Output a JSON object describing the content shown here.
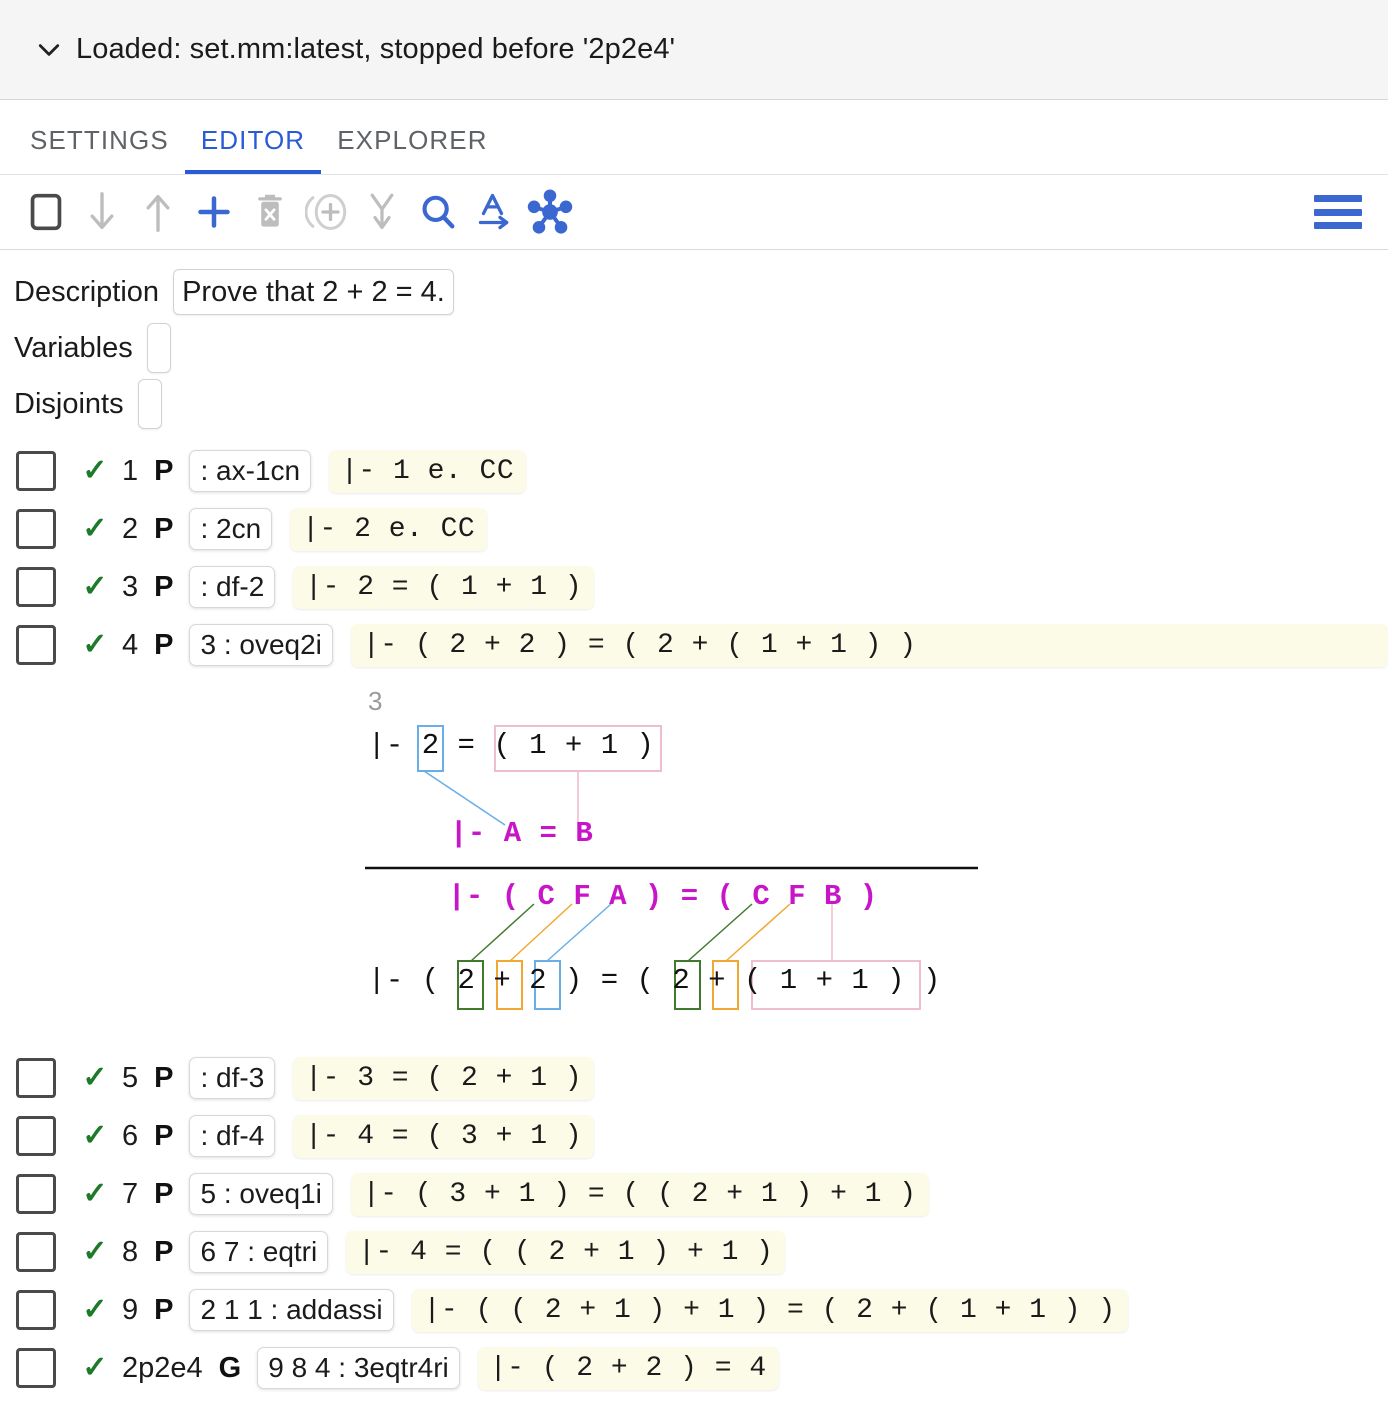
{
  "status": {
    "text": "Loaded: set.mm:latest, stopped before '2p2e4'",
    "chevron_icon": "chevron-down-icon"
  },
  "tabs": [
    {
      "label": "SETTINGS",
      "active": false
    },
    {
      "label": "EDITOR",
      "active": true
    },
    {
      "label": "EXPLORER",
      "active": false
    }
  ],
  "toolbar": {
    "icons": [
      {
        "name": "select-all-icon",
        "color": "#4a4a4a"
      },
      {
        "name": "move-down-icon",
        "color": "#bdbdbd"
      },
      {
        "name": "move-up-icon",
        "color": "#bdbdbd"
      },
      {
        "name": "add-step-icon",
        "color": "#3a68d0"
      },
      {
        "name": "delete-step-icon",
        "color": "#bdbdbd"
      },
      {
        "name": "duplicate-icon",
        "color": "#bdbdbd"
      },
      {
        "name": "merge-icon",
        "color": "#bdbdbd"
      },
      {
        "name": "search-icon",
        "color": "#3a68d0"
      },
      {
        "name": "rename-icon",
        "color": "#3a68d0"
      },
      {
        "name": "unify-icon",
        "color": "#3a68d0"
      }
    ],
    "menu_icon": "hamburger-menu-icon"
  },
  "meta": {
    "description_label": "Description",
    "description_value": "Prove that 2 + 2 = 4.",
    "variables_label": "Variables",
    "variables_value": "",
    "disjoints_label": "Disjoints",
    "disjoints_value": ""
  },
  "steps": [
    {
      "num": "1",
      "type": "P",
      "just": ": ax-1cn",
      "stmt": "|- 1 e. CC"
    },
    {
      "num": "2",
      "type": "P",
      "just": ": 2cn",
      "stmt": "|- 2 e. CC"
    },
    {
      "num": "3",
      "type": "P",
      "just": ": df-2",
      "stmt": "|- 2 = ( 1 + 1 )"
    },
    {
      "num": "4",
      "type": "P",
      "just": "3 : oveq2i",
      "stmt": "|- ( 2 + 2 ) = ( 2 + ( 1 + 1 ) )"
    },
    {
      "num": "5",
      "type": "P",
      "just": ": df-3",
      "stmt": "|- 3 = ( 2 + 1 )"
    },
    {
      "num": "6",
      "type": "P",
      "just": ": df-4",
      "stmt": "|- 4 = ( 3 + 1 )"
    },
    {
      "num": "7",
      "type": "P",
      "just": "5 : oveq1i",
      "stmt": "|- ( 3 + 1 ) = ( ( 2 + 1 ) + 1 )"
    },
    {
      "num": "8",
      "type": "P",
      "just": "6 7 : eqtri",
      "stmt": "|- 4 = ( ( 2 + 1 ) + 1 )"
    },
    {
      "num": "9",
      "type": "P",
      "just": "2 1 1 : addassi",
      "stmt": "|- ( ( 2 + 1 ) + 1 ) = ( 2 + ( 1 + 1 ) )"
    },
    {
      "num": "2p2e4",
      "type": "G",
      "just": "9 8 4 : 3eqtr4ri",
      "stmt": "|- ( 2 + 2 ) = 4"
    }
  ],
  "diagram": {
    "hyp_label": "3",
    "hyp_line": "|- 2 = ( 1 + 1 )",
    "pattern_hyp": "|- A = B",
    "pattern_concl": "|- ( C F A ) = ( C F B )",
    "result_line": "|- ( 2 + 2 ) = ( 2 + ( 1 + 1 ) )",
    "colors": {
      "blue": "#6aaee8",
      "pink": "#f0bcd0",
      "green": "#3f7a2e",
      "orange": "#f0a830",
      "magenta": "#c715c7"
    }
  }
}
